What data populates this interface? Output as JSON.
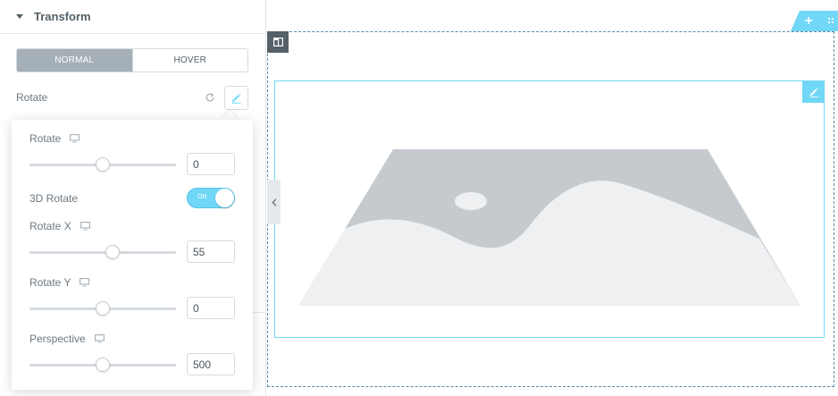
{
  "panel": {
    "section_title": "Transform",
    "tabs": [
      {
        "label": "NORMAL",
        "active": true
      },
      {
        "label": "HOVER",
        "active": false
      }
    ],
    "rotate_label": "Rotate"
  },
  "popover": {
    "rotate": {
      "label": "Rotate",
      "value": "0",
      "slider_fraction": 0.5
    },
    "rotate_3d": {
      "label": "3D Rotate",
      "toggle_text": "ON",
      "enabled": true
    },
    "rotate_x": {
      "label": "Rotate X",
      "value": "55",
      "slider_fraction": 0.57
    },
    "rotate_y": {
      "label": "Rotate Y",
      "value": "0",
      "slider_fraction": 0.5
    },
    "perspective": {
      "label": "Perspective",
      "value": "500",
      "slider_fraction": 0.5
    }
  },
  "icons": {
    "caret": "caret-down-icon",
    "reset": "reset-icon",
    "edit": "pencil-icon",
    "responsive": "desktop-monitor-icon",
    "add_section": "plus-icon",
    "drag_section": "drag-handle-icon",
    "column": "column-layout-icon",
    "collapse": "chevron-left-icon",
    "placeholder": "image-placeholder-icon"
  },
  "colors": {
    "accent": "#71d7f7",
    "active_tab": "#a4afb7",
    "column_handle": "#556068",
    "section_outline": "#5d87a3",
    "placeholder_dark": "#c5cacf",
    "placeholder_light": "#eef0f2"
  }
}
